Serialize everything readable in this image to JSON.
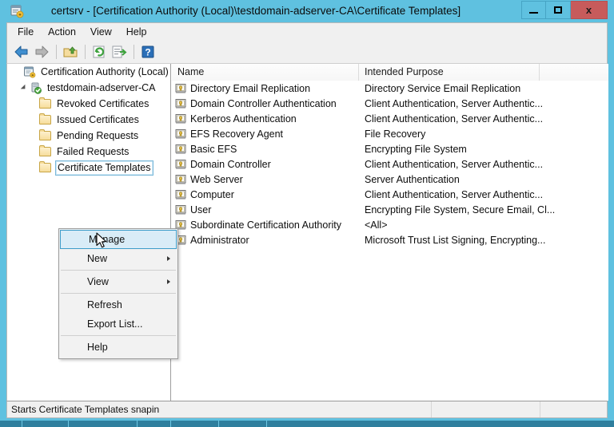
{
  "window": {
    "title": "certsrv - [Certification Authority (Local)\\testdomain-adserver-CA\\Certificate Templates]",
    "icon": "mmc-console-icon",
    "minimize_label": "",
    "maximize_label": "",
    "close_label": "x"
  },
  "menubar": {
    "items": [
      {
        "label": "File"
      },
      {
        "label": "Action"
      },
      {
        "label": "View"
      },
      {
        "label": "Help"
      }
    ]
  },
  "toolbar": {
    "buttons": [
      {
        "name": "back-icon",
        "title": "Back"
      },
      {
        "name": "forward-icon",
        "title": "Forward"
      },
      {
        "name": "up-one-level-icon",
        "title": "Up One Level"
      },
      {
        "name": "refresh-icon",
        "title": "Refresh"
      },
      {
        "name": "export-list-icon",
        "title": "Export List"
      },
      {
        "name": "help-icon",
        "title": "Help"
      }
    ]
  },
  "tree": {
    "nodes": [
      {
        "label": "Certification Authority (Local)",
        "icon": "ca-root-icon",
        "indent": 0,
        "expander": false,
        "selected": false
      },
      {
        "label": "testdomain-adserver-CA",
        "icon": "ca-server-icon",
        "indent": 1,
        "expander": true,
        "selected": false
      },
      {
        "label": "Revoked Certificates",
        "icon": "folder-icon",
        "indent": 2,
        "expander": false,
        "selected": false
      },
      {
        "label": "Issued Certificates",
        "icon": "folder-icon",
        "indent": 2,
        "expander": false,
        "selected": false
      },
      {
        "label": "Pending Requests",
        "icon": "folder-icon",
        "indent": 2,
        "expander": false,
        "selected": false
      },
      {
        "label": "Failed Requests",
        "icon": "folder-icon",
        "indent": 2,
        "expander": false,
        "selected": false
      },
      {
        "label": "Certificate Templates",
        "icon": "folder-icon",
        "indent": 2,
        "expander": false,
        "selected": true
      }
    ]
  },
  "list": {
    "columns": [
      {
        "label": "Name"
      },
      {
        "label": "Intended Purpose"
      },
      {
        "label": ""
      }
    ],
    "rows": [
      {
        "name": "Directory Email Replication",
        "purpose": "Directory Service Email Replication"
      },
      {
        "name": "Domain Controller Authentication",
        "purpose": "Client Authentication, Server Authentic..."
      },
      {
        "name": "Kerberos Authentication",
        "purpose": "Client Authentication, Server Authentic..."
      },
      {
        "name": "EFS Recovery Agent",
        "purpose": "File Recovery"
      },
      {
        "name": "Basic EFS",
        "purpose": "Encrypting File System"
      },
      {
        "name": "Domain Controller",
        "purpose": "Client Authentication, Server Authentic..."
      },
      {
        "name": "Web Server",
        "purpose": "Server Authentication"
      },
      {
        "name": "Computer",
        "purpose": "Client Authentication, Server Authentic..."
      },
      {
        "name": "User",
        "purpose": "Encrypting File System, Secure Email, Cl..."
      },
      {
        "name": "Subordinate Certification Authority",
        "purpose": "<All>"
      },
      {
        "name": "Administrator",
        "purpose": "Microsoft Trust List Signing, Encrypting..."
      }
    ]
  },
  "context_menu": {
    "items": [
      {
        "label": "Manage",
        "highlighted": true,
        "submenu": false,
        "separator_after": false
      },
      {
        "label": "New",
        "highlighted": false,
        "submenu": true,
        "separator_after": true
      },
      {
        "label": "View",
        "highlighted": false,
        "submenu": true,
        "separator_after": true
      },
      {
        "label": "Refresh",
        "highlighted": false,
        "submenu": false,
        "separator_after": false
      },
      {
        "label": "Export List...",
        "highlighted": false,
        "submenu": false,
        "separator_after": true
      },
      {
        "label": "Help",
        "highlighted": false,
        "submenu": false,
        "separator_after": false
      }
    ]
  },
  "statusbar": {
    "message": "Starts Certificate Templates snapin",
    "segment2": "",
    "segment3": ""
  },
  "colors": {
    "window_frame": "#5fc1e0",
    "close_button": "#c75b5b",
    "highlight": "#d9ecf7",
    "highlight_border": "#3d9cc9",
    "folder": "#f7dd9c"
  }
}
